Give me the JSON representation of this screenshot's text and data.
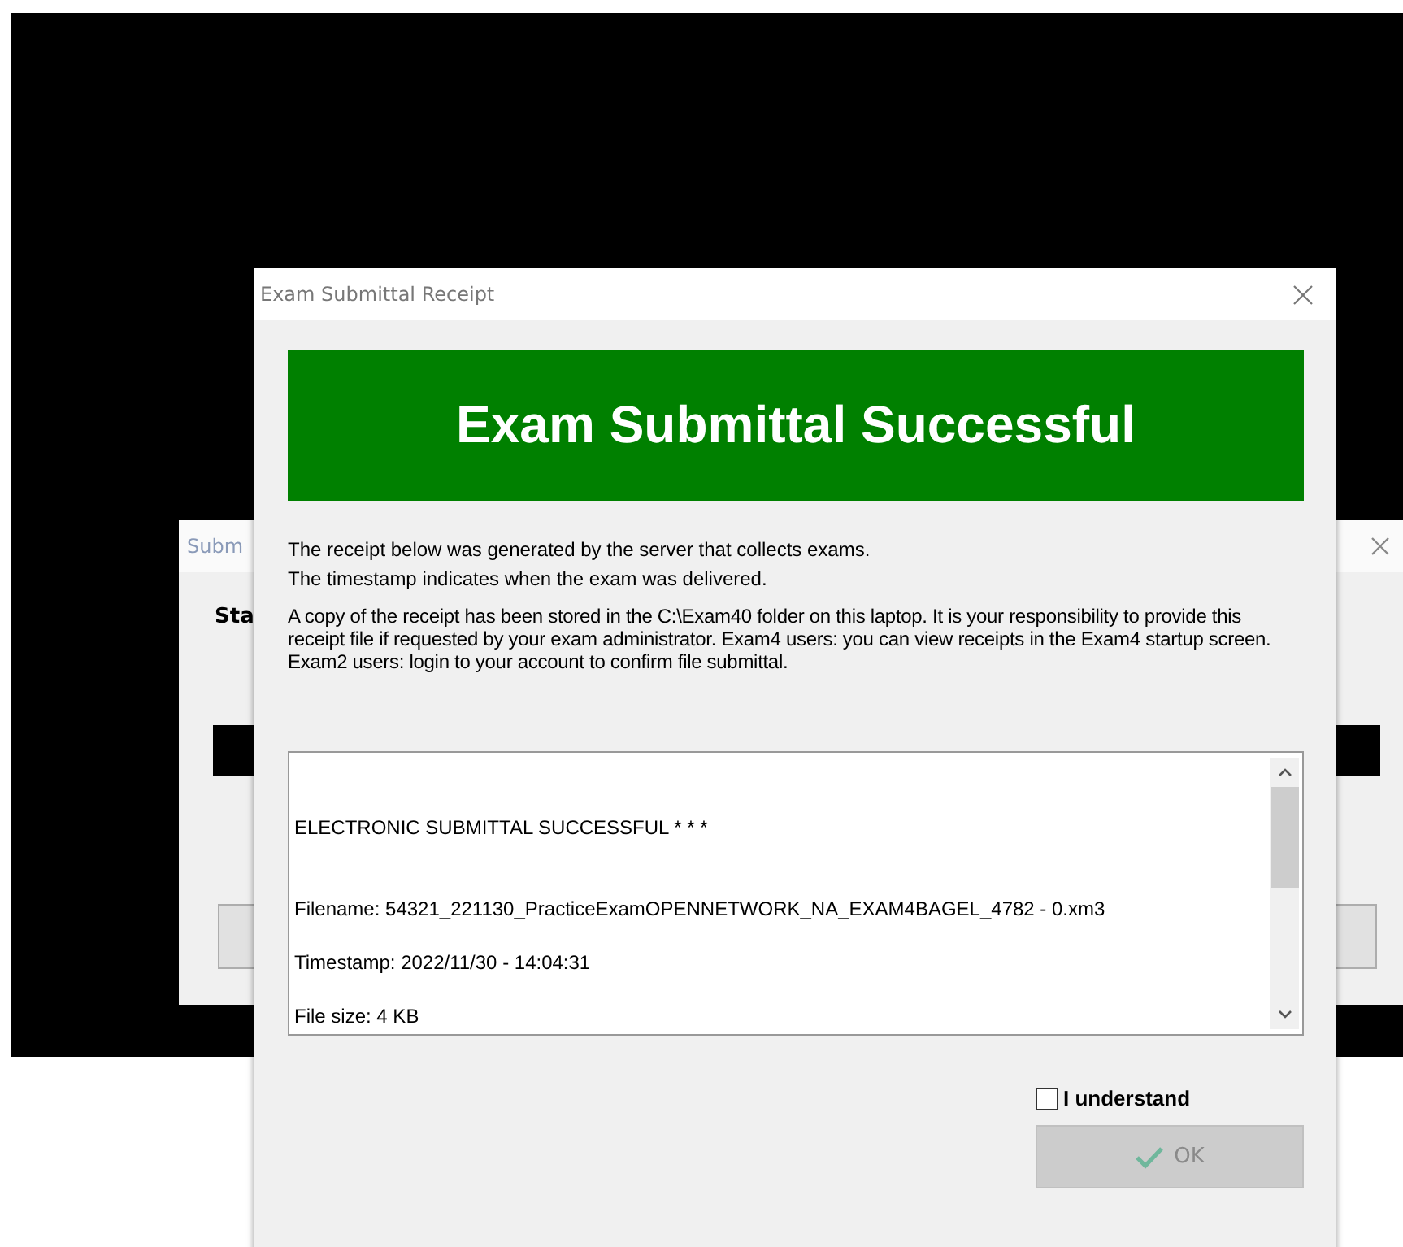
{
  "back_dialog": {
    "title": "Subm",
    "status_label": "Sta"
  },
  "dialog": {
    "title": "Exam Submittal Receipt",
    "banner": "Exam Submittal Successful",
    "intro_lines": [
      "The receipt below was generated by the server that collects exams.",
      "The timestamp indicates when the exam was delivered."
    ],
    "notice": "A copy of the receipt has been stored in the C:\\Exam40 folder on this laptop. It is your responsibility to provide this receipt file if requested by your exam administrator. Exam4 users: you can view receipts in the Exam4 startup screen. Exam2 users: login to your account to confirm file submittal.",
    "receipt_lines": [
      "ELECTRONIC SUBMITTAL SUCCESSFUL * * *",
      "Filename: 54321_221130_PracticeExamOPENNETWORK_NA_EXAM4BAGEL_4782 - 0.xm3",
      "Timestamp: 2022/11/30 - 14:04:31",
      "File size: 4 KB"
    ],
    "understand": {
      "label": "I understand",
      "checked": false
    },
    "ok_button": {
      "label": "OK",
      "disabled": true
    }
  }
}
